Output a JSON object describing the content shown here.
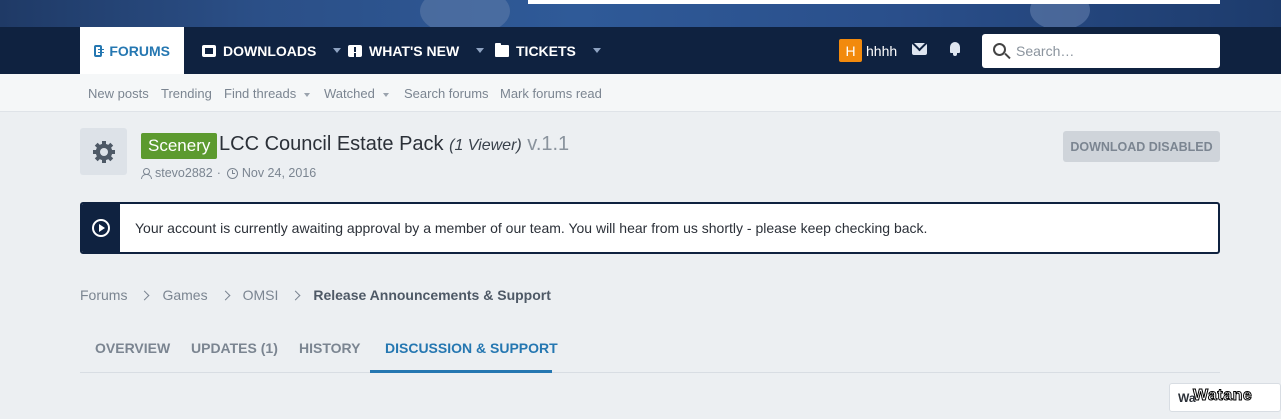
{
  "nav": {
    "tabs": [
      {
        "label": "FORUMS",
        "icon": "forums-icon",
        "active": true
      },
      {
        "label": "DOWNLOADS",
        "icon": "downloads-icon"
      },
      {
        "label": "WHAT'S NEW",
        "icon": "whats-new-icon"
      },
      {
        "label": "TICKETS",
        "icon": "folder-icon"
      }
    ],
    "user": {
      "avatar_letter": "H",
      "name": "hhhh",
      "avatar_color": "#f28a0d"
    },
    "search_placeholder": "Search…"
  },
  "subnav": {
    "items": [
      "New posts",
      "Trending",
      "Find threads",
      "Watched",
      "Search forums",
      "Mark forums read"
    ]
  },
  "resource": {
    "prefix": "Scenery",
    "title": "LCC Council Estate Pack",
    "viewers": "(1 Viewer)",
    "version": "v.1.1",
    "author": "stevo2882",
    "date": "Nov 24, 2016",
    "download_label": "DOWNLOAD DISABLED"
  },
  "notice": {
    "text": "Your account is currently awaiting approval by a member of our team. You will hear from us shortly - please keep checking back."
  },
  "breadcrumb": [
    "Forums",
    "Games",
    "OMSI",
    "Release Announcements & Support"
  ],
  "tabs": [
    "OVERVIEW",
    "UPDATES (1)",
    "HISTORY",
    "DISCUSSION & SUPPORT"
  ],
  "corner_button": "Wa",
  "watermark": "Watane",
  "colors": {
    "navbar": "#0f2240",
    "accent": "#2577b1",
    "prefix": "#5c9a2f"
  }
}
